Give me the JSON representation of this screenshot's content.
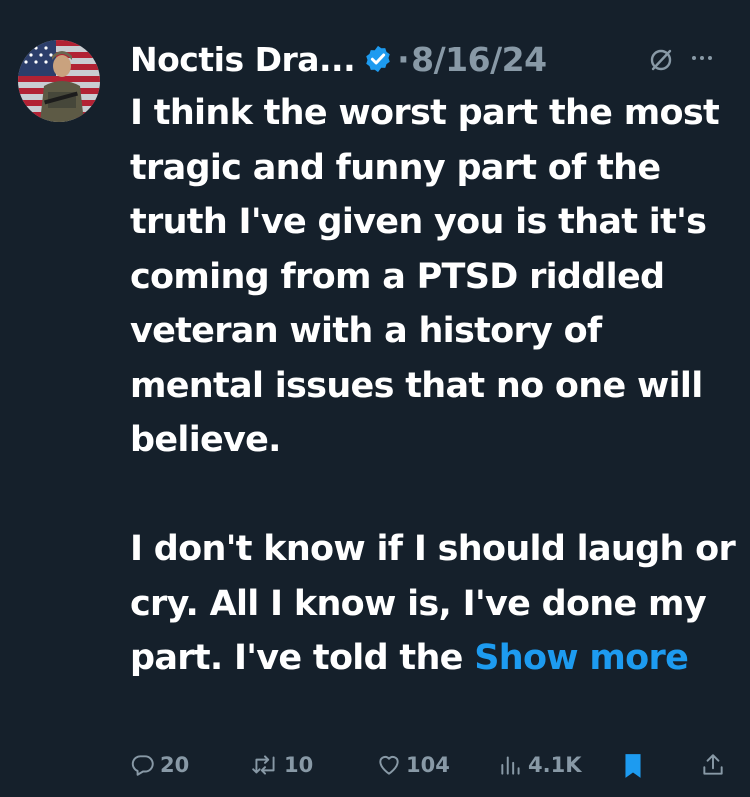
{
  "tweet": {
    "author_name": "Noctis Dra...",
    "separator": "·",
    "date": "8/16/24",
    "paragraph1": "I think the worst part the most tragic and funny part of the truth I've given you is that it's coming from a PTSD riddled veteran with a history of mental issues that no one will believe.",
    "paragraph2": "I don't know if I should laugh or cry. All I know is, I've done my part. I've told the",
    "show_more": "Show more"
  },
  "actions": {
    "replies": "20",
    "reposts": "10",
    "likes": "104",
    "views": "4.1K"
  },
  "colors": {
    "background": "#15202b",
    "accent": "#1d9bf0",
    "muted": "#8899a6",
    "text": "#ffffff"
  },
  "icons": [
    "reply-icon",
    "repost-icon",
    "like-icon",
    "views-icon",
    "bookmark-icon",
    "share-icon",
    "verified-badge-icon",
    "grok-icon",
    "more-options-icon"
  ]
}
